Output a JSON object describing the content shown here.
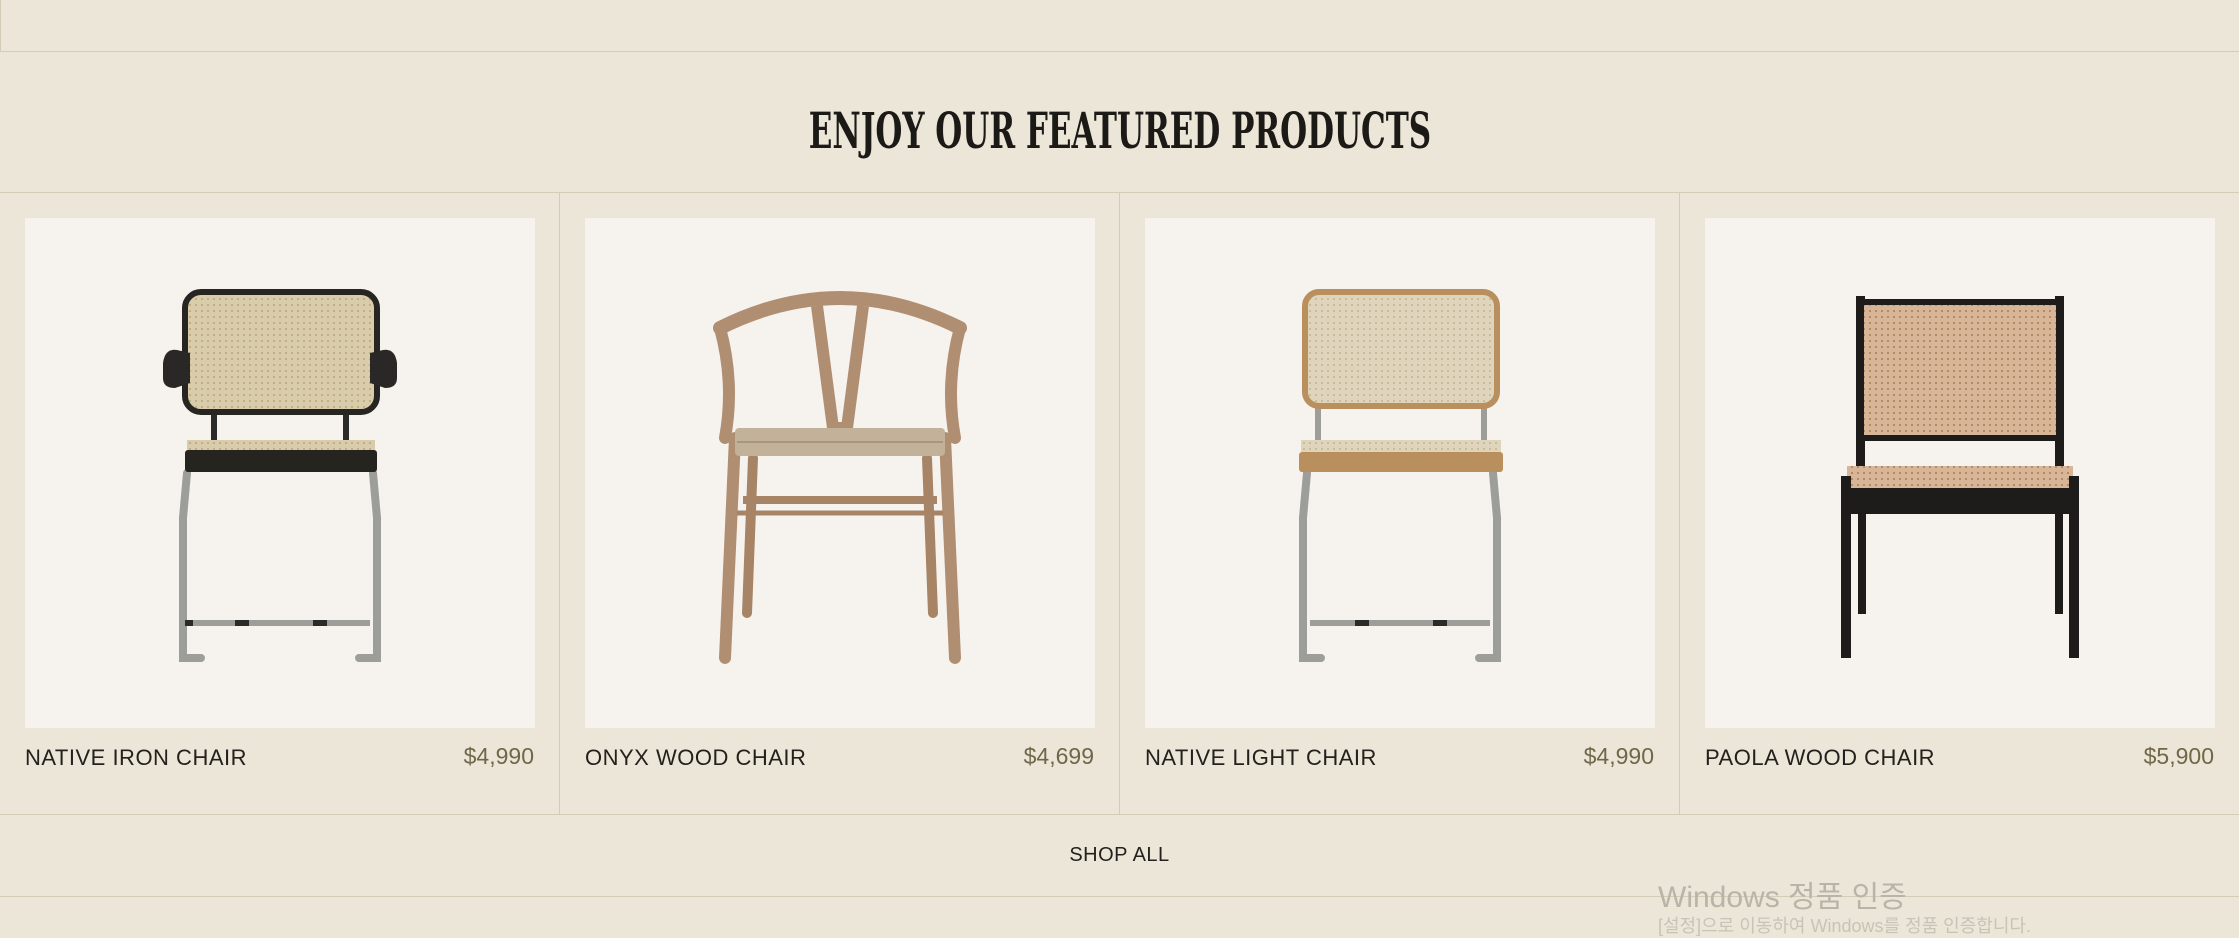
{
  "section": {
    "heading": "ENJOY OUR FEATURED PRODUCTS",
    "shop_all_label": "SHOP ALL"
  },
  "products": [
    {
      "name": "NATIVE IRON CHAIR",
      "price": "$4,990",
      "icon": "cantilever-cane-armchair"
    },
    {
      "name": "ONYX WOOD CHAIR",
      "price": "$4,699",
      "icon": "wishbone-wood-chair"
    },
    {
      "name": "NATIVE LIGHT CHAIR",
      "price": "$4,990",
      "icon": "cantilever-cane-chair"
    },
    {
      "name": "PAOLA WOOD CHAIR",
      "price": "$5,900",
      "icon": "black-frame-cane-lounge-chair"
    }
  ],
  "colors": {
    "background": "#ece6d8",
    "card_image_bg": "#f6f3ee",
    "border": "#d3ccb6",
    "price": "#6f6747"
  },
  "overlay": {
    "watermark": "Windows 정품 인증",
    "watermark_sub": "[설정]으로 이동하여 Windows를 정품 인증합니다."
  }
}
